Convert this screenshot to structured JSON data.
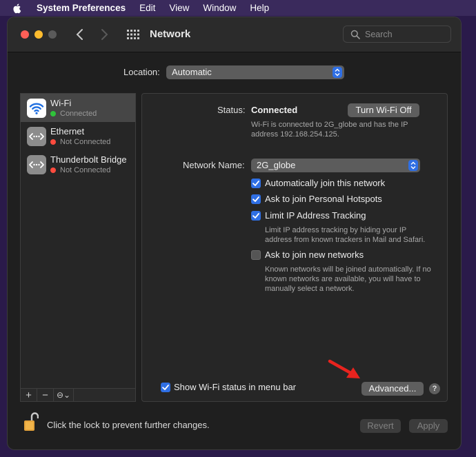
{
  "menubar": {
    "app_name": "System Preferences",
    "items": [
      "Edit",
      "View",
      "Window",
      "Help"
    ]
  },
  "window": {
    "title": "Network",
    "search_placeholder": "Search"
  },
  "location": {
    "label": "Location:",
    "value": "Automatic"
  },
  "services": [
    {
      "name": "Wi-Fi",
      "status": "Connected",
      "status_color": "#2fc23a",
      "icon": "wifi-icon",
      "selected": true
    },
    {
      "name": "Ethernet",
      "status": "Not Connected",
      "status_color": "#ff4b3e",
      "icon": "ethernet-icon",
      "selected": false
    },
    {
      "name": "Thunderbolt Bridge",
      "status": "Not Connected",
      "status_color": "#ff4b3e",
      "icon": "thunderbolt-bridge-icon",
      "selected": false
    }
  ],
  "sidebar_tools": {
    "add": "+",
    "remove": "−",
    "action": "⊖⌄"
  },
  "detail": {
    "status_label": "Status:",
    "status_value": "Connected",
    "turn_off_button": "Turn Wi-Fi Off",
    "status_desc_line1": "Wi-Fi is connected to 2G_globe and has the IP",
    "status_desc_line2": "address 192.168.254.125.",
    "network_name_label": "Network Name:",
    "network_name_value": "2G_globe",
    "options": [
      {
        "label": "Automatically join this network",
        "checked": true
      },
      {
        "label": "Ask to join Personal Hotspots",
        "checked": true
      },
      {
        "label": "Limit IP Address Tracking",
        "checked": true
      },
      {
        "label": "Ask to join new networks",
        "checked": false
      }
    ],
    "limit_ip_desc_line1": "Limit IP address tracking by hiding your IP",
    "limit_ip_desc_line2": "address from known trackers in Mail and Safari.",
    "new_networks_desc_line1": "Known networks will be joined automatically. If no",
    "new_networks_desc_line2": "known networks are available, you will have to",
    "new_networks_desc_line3": "manually select a network.",
    "show_status_label": "Show Wi-Fi status in menu bar",
    "show_status_checked": true,
    "advanced_button": "Advanced...",
    "help_button": "?"
  },
  "footer": {
    "lock_text": "Click the lock to prevent further changes.",
    "revert_button": "Revert",
    "apply_button": "Apply"
  },
  "colors": {
    "accent": "#2f6fe4",
    "annotation_arrow": "#e8231e"
  }
}
